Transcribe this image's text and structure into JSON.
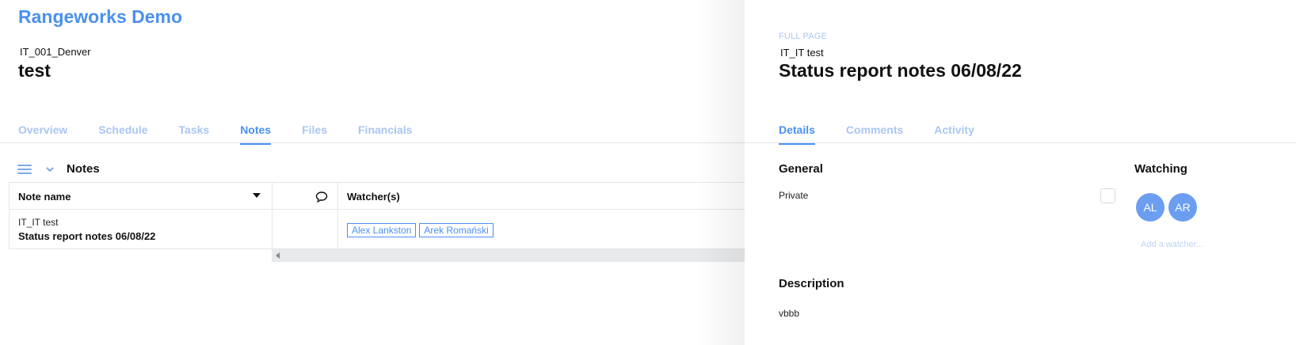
{
  "app": {
    "title": "Rangeworks Demo"
  },
  "project": {
    "code": "IT_001_Denver",
    "name": "test"
  },
  "main_tabs": [
    {
      "label": "Overview",
      "active": false
    },
    {
      "label": "Schedule",
      "active": false
    },
    {
      "label": "Tasks",
      "active": false
    },
    {
      "label": "Notes",
      "active": true
    },
    {
      "label": "Files",
      "active": false
    },
    {
      "label": "Financials",
      "active": false
    }
  ],
  "notes_section": {
    "title": "Notes",
    "icons": [
      "hamburger-icon",
      "chevron-down-icon"
    ]
  },
  "notes_table": {
    "columns": {
      "name": "Note name",
      "comments_icon": "comment-icon",
      "watchers": "Watcher(s)"
    },
    "rows": [
      {
        "project": "IT_IT test",
        "note": "Status report notes 06/08/22",
        "watchers": [
          "Alex Lankston",
          "Arek Romański"
        ]
      }
    ]
  },
  "detail_panel": {
    "full_page_link": "FULL PAGE",
    "project": "IT_IT test",
    "title": "Status report notes 06/08/22",
    "tabs": [
      {
        "label": "Details",
        "active": true
      },
      {
        "label": "Comments",
        "active": false
      },
      {
        "label": "Activity",
        "active": false
      }
    ],
    "general": {
      "heading": "General",
      "private_label": "Private",
      "private_checked": false
    },
    "watching": {
      "heading": "Watching",
      "avatars": [
        "AL",
        "AR"
      ],
      "add_placeholder": "Add a watcher..."
    },
    "description": {
      "heading": "Description",
      "text": "vbbb"
    }
  },
  "colors": {
    "accent": "#4a90f0",
    "tab_inactive": "#a9c6f2",
    "avatar": "#6b9ef0"
  }
}
